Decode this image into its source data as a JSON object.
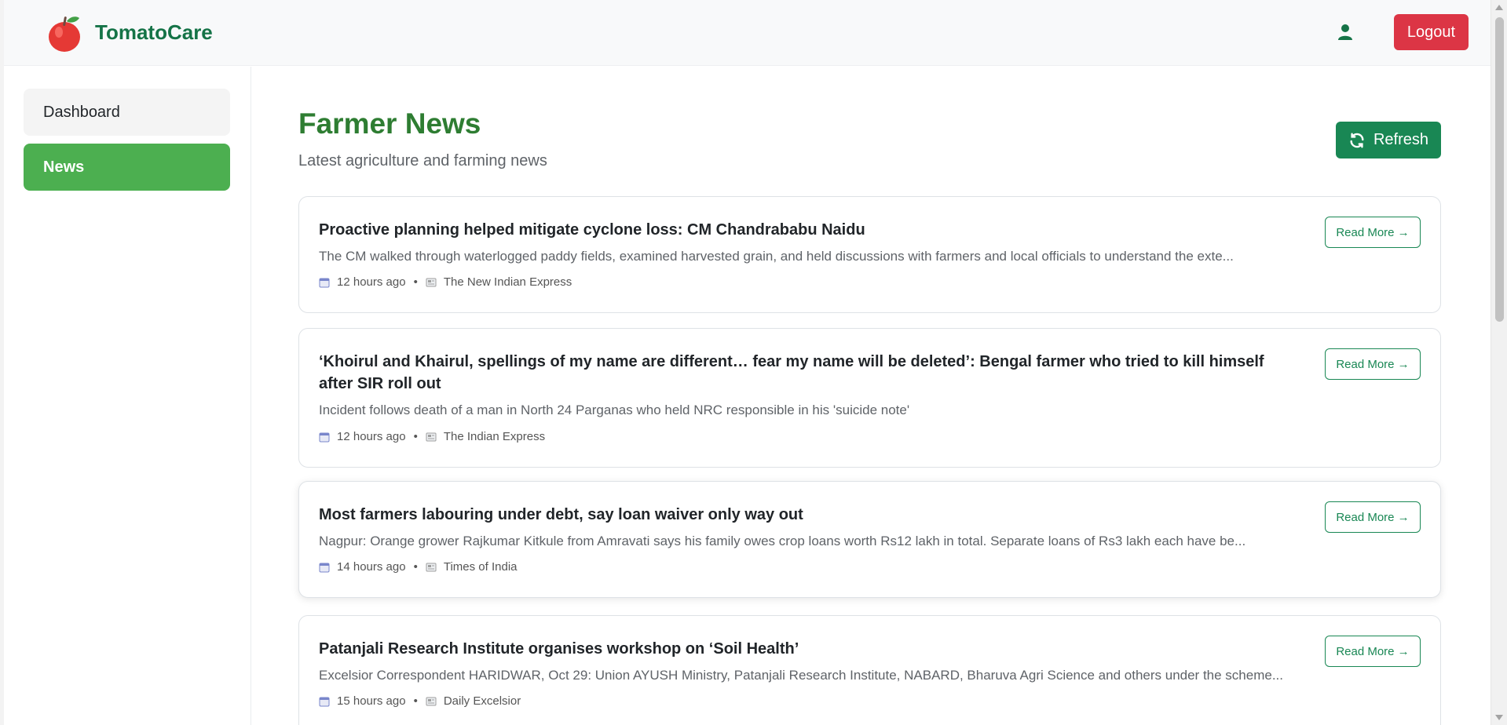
{
  "header": {
    "brand_name": "TomatoCare",
    "logo_icon": "apple-icon",
    "user_icon": "user-icon",
    "logout_label": "Logout"
  },
  "sidebar": {
    "items": [
      {
        "label": "Dashboard",
        "active": false
      },
      {
        "label": "News",
        "active": true
      }
    ]
  },
  "main": {
    "title": "Farmer News",
    "subtitle": "Latest agriculture and farming news",
    "refresh_label": "Refresh",
    "read_more_label": "Read More →",
    "articles": [
      {
        "title": "Proactive planning helped mitigate cyclone loss: CM Chandrababu Naidu",
        "description": "The CM walked through waterlogged paddy fields, examined harvested grain, and held discussions with farmers and local officials to understand the exte...",
        "time": "12 hours ago",
        "source": "The New Indian Express"
      },
      {
        "title": "‘Khoirul and Khairul, spellings of my name are different… fear my name will be deleted’: Bengal farmer who tried to kill himself after SIR roll out",
        "description": "Incident follows death of a man in North 24 Parganas who held NRC responsible in his 'suicide note'",
        "time": "12 hours ago",
        "source": "The Indian Express"
      },
      {
        "title": "Most farmers labouring under debt, say loan waiver only way out",
        "description": "Nagpur: Orange grower Rajkumar Kitkule from Amravati says his family owes crop loans worth Rs12 lakh in total. Separate loans of Rs3 lakh each have be...",
        "time": "14 hours ago",
        "source": "Times of India"
      },
      {
        "title": "Patanjali Research Institute organises workshop on ‘Soil Health’",
        "description": "Excelsior Correspondent HARIDWAR, Oct 29: Union AYUSH Ministry, Patanjali Research Institute, NABARD, Bharuva Agri Science and others under the scheme...",
        "time": "15 hours ago",
        "source": "Daily Excelsior"
      }
    ]
  },
  "colors": {
    "brand_green": "#157347",
    "active_nav": "#4caf50",
    "title_green": "#2e7d32",
    "logout_red": "#dc3545"
  }
}
